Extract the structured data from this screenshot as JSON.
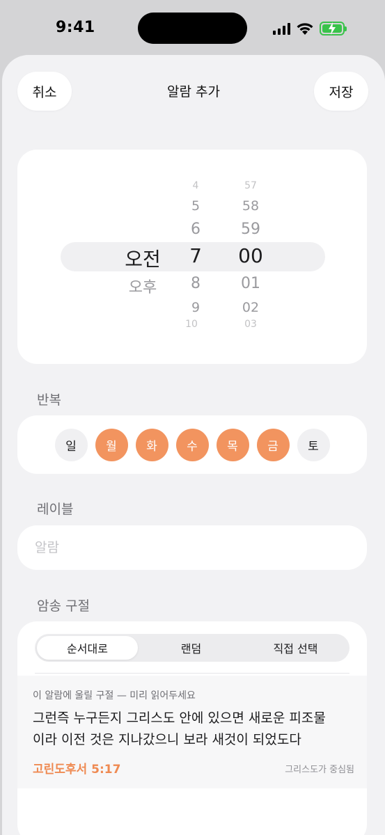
{
  "status_bar": {
    "time": "9:41"
  },
  "nav": {
    "cancel": "취소",
    "title": "알람 추가",
    "save": "저장"
  },
  "picker": {
    "ampm": {
      "options": [
        "오전",
        "오후"
      ],
      "selected": "오전"
    },
    "hours": [
      "4",
      "5",
      "6",
      "7",
      "8",
      "9",
      "10"
    ],
    "hour_selected": "7",
    "minutes": [
      "57",
      "58",
      "59",
      "00",
      "01",
      "02",
      "03"
    ],
    "minute_selected": "00"
  },
  "repeat": {
    "label": "반복",
    "days": [
      {
        "label": "일",
        "selected": false
      },
      {
        "label": "월",
        "selected": true
      },
      {
        "label": "화",
        "selected": true
      },
      {
        "label": "수",
        "selected": true
      },
      {
        "label": "목",
        "selected": true
      },
      {
        "label": "금",
        "selected": true
      },
      {
        "label": "토",
        "selected": false
      }
    ]
  },
  "label_section": {
    "label": "레이블",
    "placeholder": "알람",
    "value": ""
  },
  "verse": {
    "label": "암송 구절",
    "modes": [
      "순서대로",
      "랜덤",
      "직접 선택"
    ],
    "active_mode": "순서대로",
    "preview_hint": "이 알람에 울릴 구절 — 미리 읽어두세요",
    "text_line1": "그런즉 누구든지 그리스도 안에 있으면 새로운 피조물",
    "text_line2": "이라 이전 것은 지나갔으니 보라 새것이 되었도다",
    "reference": "고린도후서 5:17",
    "theme": "그리스도가 중심됨"
  },
  "colors": {
    "accent": "#f2945f",
    "reference": "#ef8a52",
    "battery": "#39c34a"
  },
  "icons": [
    "signal-icon",
    "wifi-icon",
    "battery-charging-icon"
  ]
}
